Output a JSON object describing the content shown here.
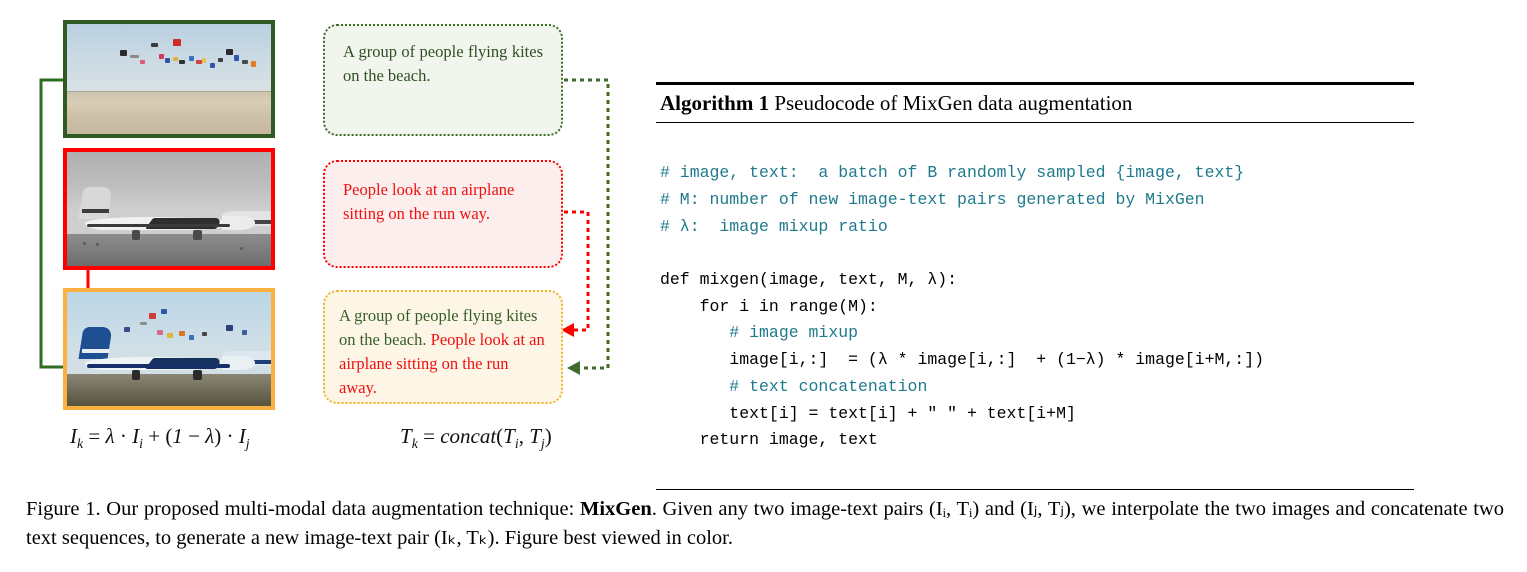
{
  "figure": {
    "images": [
      {
        "name": "beach-kites-photo",
        "alt": "beach with many kites flying",
        "border_color": "#2f5a23"
      },
      {
        "name": "airplane-photo",
        "alt": "black and white airplane on runway",
        "border_color": "#ff0000"
      },
      {
        "name": "mixed-photo",
        "alt": "blended airplane and kite beach image",
        "border_color": "#fbb040"
      }
    ],
    "captions": {
      "green": "A group of people flying kites on the beach.",
      "red": "People look at an airplane sitting on the run way.",
      "mixed_part1": "A group of people flying kites on the beach. ",
      "mixed_part2": "People look at an airplane sitting on the run away."
    },
    "formulas": {
      "image_mix_lhs": "I",
      "image_mix": "Iₖ = λ · Iᵢ + (1 − λ) · Iⱼ",
      "text_concat": "Tₖ = concat(Tᵢ, Tⱼ)"
    },
    "colors": {
      "green": "#2f5a23",
      "red": "#ff0000",
      "amber": "#fbb040",
      "comment_teal": "#1f7a8c"
    }
  },
  "algorithm": {
    "label": "Algorithm 1",
    "title": " Pseudocode of MixGen data augmentation",
    "lines": [
      {
        "type": "comment",
        "text": "# image, text:  a batch of B randomly sampled {image, text}"
      },
      {
        "type": "comment",
        "text": "# M: number of new image-text pairs generated by MixGen"
      },
      {
        "type": "comment",
        "text": "# λ:  image mixup ratio"
      },
      {
        "type": "blank",
        "text": ""
      },
      {
        "type": "code",
        "text": "def mixgen(image, text, M, λ):"
      },
      {
        "type": "code",
        "text": "    for i in range(M):"
      },
      {
        "type": "comment",
        "text": "       # image mixup"
      },
      {
        "type": "code",
        "text": "       image[i,:]  = (λ * image[i,:]  + (1−λ) * image[i+M,:])"
      },
      {
        "type": "comment",
        "text": "       # text concatenation"
      },
      {
        "type": "code",
        "text": "       text[i] = text[i] + \" \" + text[i+M]"
      },
      {
        "type": "code",
        "text": "    return image, text"
      }
    ]
  },
  "caption": {
    "part1": "Figure 1. Our proposed multi-modal data augmentation technique: ",
    "bold": "MixGen",
    "part2": ". Given any two image-text pairs (Iᵢ, Tᵢ) and (Iⱼ, Tⱼ), we interpolate the two images and concatenate two text sequences, to generate a new image-text pair (Iₖ, Tₖ). Figure best viewed in color."
  }
}
